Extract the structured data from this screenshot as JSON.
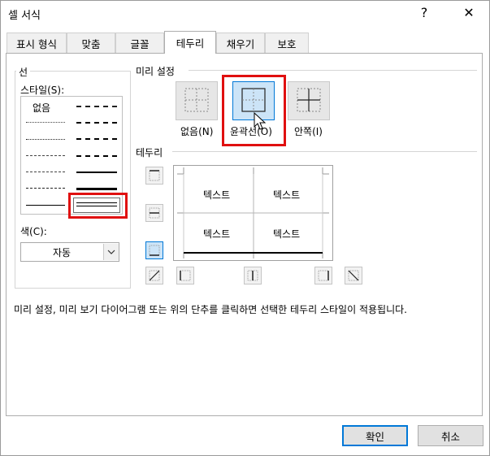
{
  "window": {
    "title": "셀 서식",
    "help_label": "?",
    "close_label": "✕"
  },
  "tabs": [
    "표시 형식",
    "맞춤",
    "글꼴",
    "테두리",
    "채우기",
    "보호"
  ],
  "active_tab": "테두리",
  "line_section": {
    "label": "선",
    "style_label": "스타일(S):",
    "none_label": "없음",
    "color_label": "색(C):",
    "color_value": "자동",
    "color_dropdown_icon": "chevron-down-icon"
  },
  "presets": {
    "label": "미리 설정",
    "items": [
      {
        "label": "없음(N)"
      },
      {
        "label": "윤곽선(O)"
      },
      {
        "label": "안쪽(I)"
      }
    ]
  },
  "border_section": {
    "label": "테두리",
    "preview_text": [
      "텍스트",
      "텍스트",
      "텍스트",
      "텍스트"
    ]
  },
  "description": "미리 설정, 미리 보기 다이어그램 또는 위의 단추를 클릭하면 선택한 테두리 스타일이 적용됩니다.",
  "buttons": {
    "ok": "확인",
    "cancel": "취소"
  },
  "colors": {
    "highlight_red": "#e01010",
    "accent_blue": "#0078d7"
  }
}
